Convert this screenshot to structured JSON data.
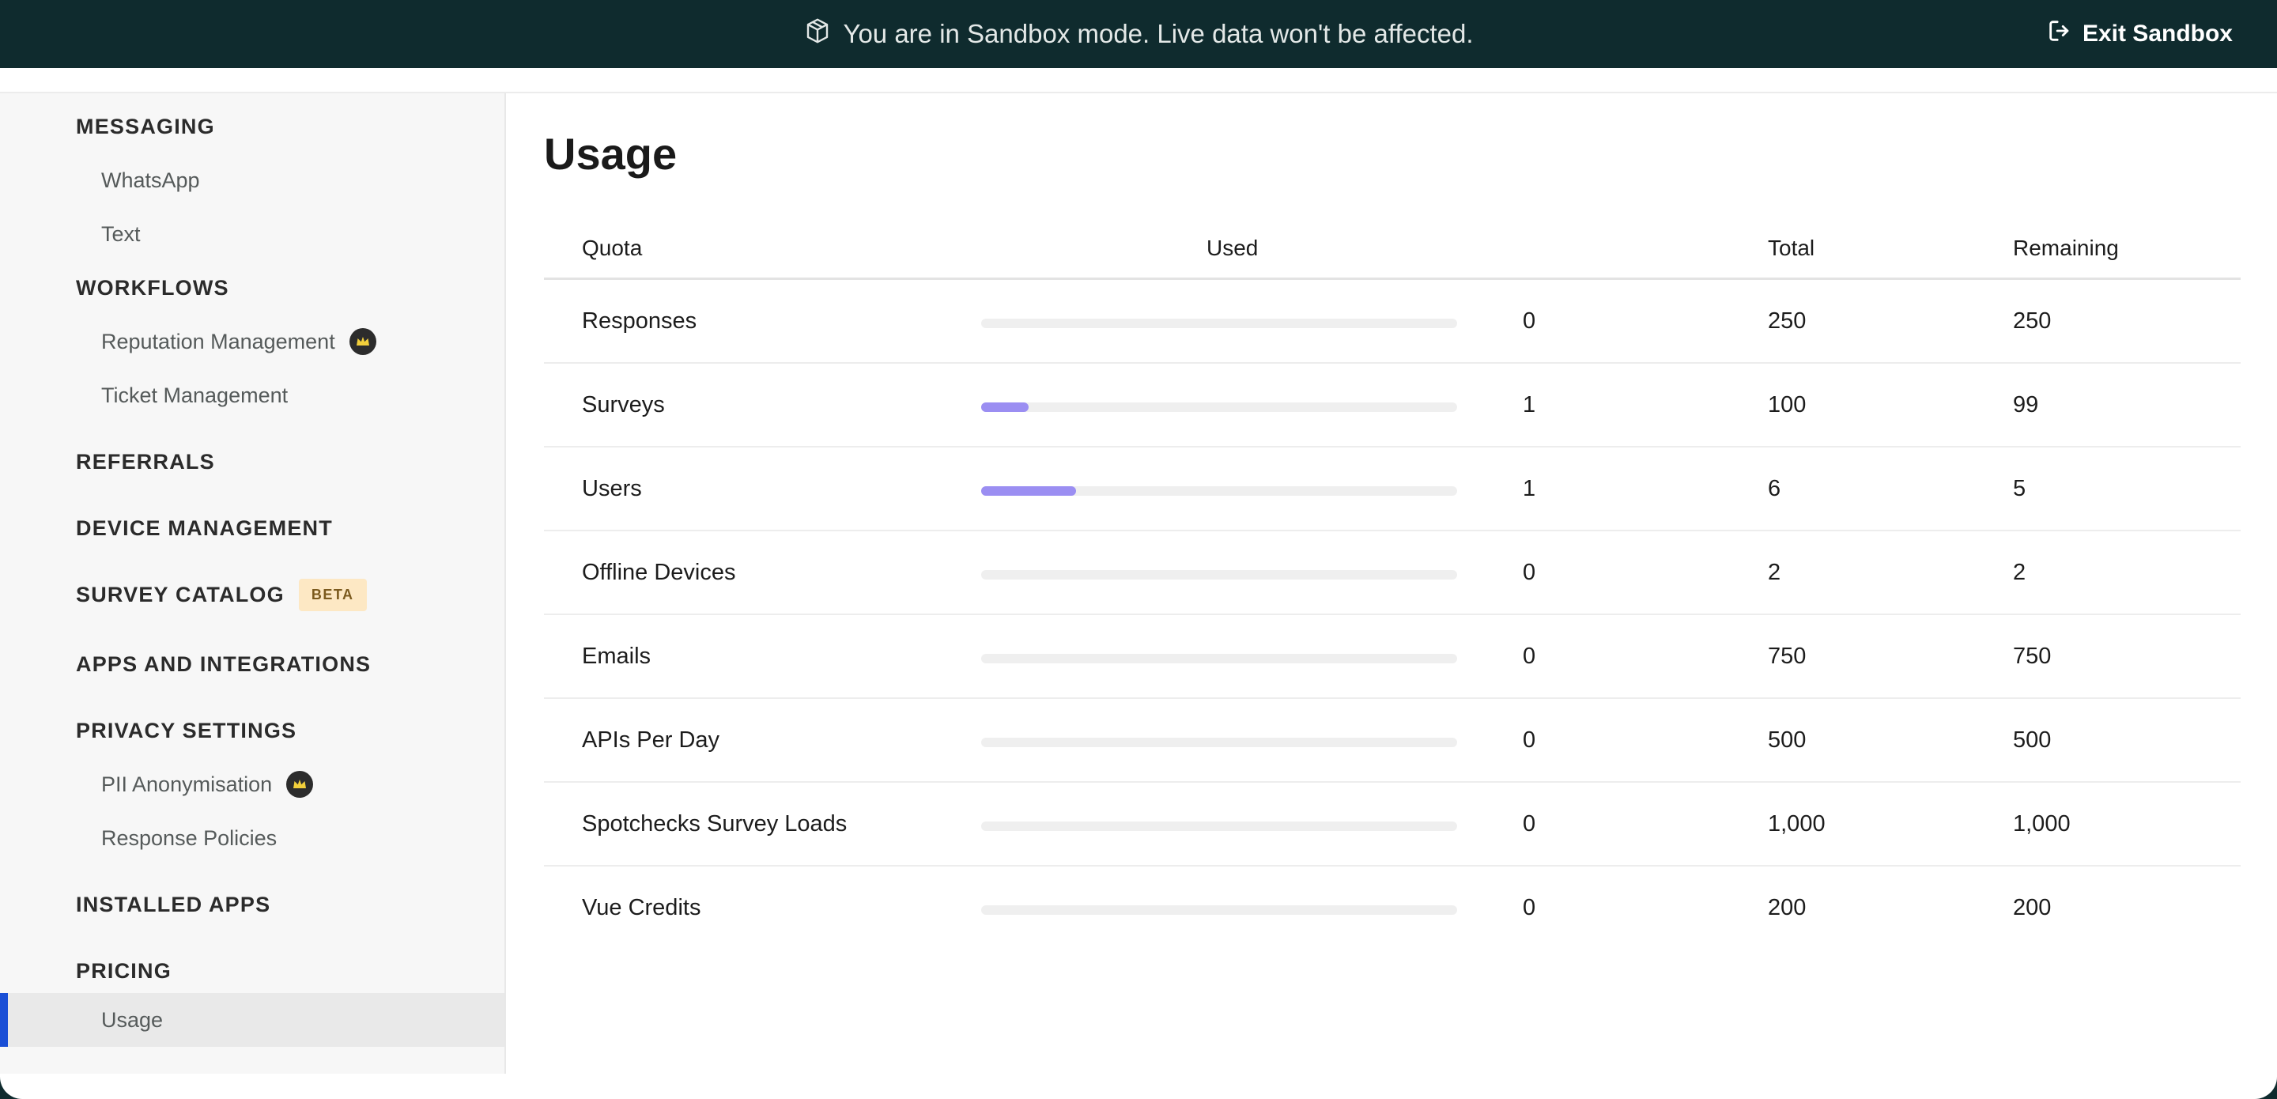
{
  "banner": {
    "message": "You are in Sandbox mode. Live data won't be affected.",
    "exit_label": "Exit Sandbox",
    "icon": "package-icon"
  },
  "sidebar": {
    "items": [
      {
        "label": "MESSAGING",
        "kind": "section"
      },
      {
        "label": "WhatsApp",
        "kind": "sub"
      },
      {
        "label": "Text",
        "kind": "sub"
      },
      {
        "label": "WORKFLOWS",
        "kind": "section"
      },
      {
        "label": "Reputation Management",
        "kind": "sub",
        "badge": "crown-icon"
      },
      {
        "label": "Ticket Management",
        "kind": "sub"
      },
      {
        "label": "REFERRALS",
        "kind": "section"
      },
      {
        "label": "DEVICE MANAGEMENT",
        "kind": "section"
      },
      {
        "label": "SURVEY CATALOG",
        "kind": "section",
        "tag": "BETA"
      },
      {
        "label": "APPS AND INTEGRATIONS",
        "kind": "section"
      },
      {
        "label": "PRIVACY SETTINGS",
        "kind": "section"
      },
      {
        "label": "PII Anonymisation",
        "kind": "sub",
        "badge": "crown-icon"
      },
      {
        "label": "Response Policies",
        "kind": "sub"
      },
      {
        "label": "INSTALLED APPS",
        "kind": "section"
      },
      {
        "label": "PRICING",
        "kind": "section"
      },
      {
        "label": "Usage",
        "kind": "sub",
        "active": true
      }
    ]
  },
  "main": {
    "title": "Usage",
    "table": {
      "headers": {
        "quota": "Quota",
        "used": "Used",
        "total": "Total",
        "remaining": "Remaining"
      },
      "rows": [
        {
          "quota": "Responses",
          "used": "0",
          "total": "250",
          "remaining": "250",
          "fraction": 0
        },
        {
          "quota": "Surveys",
          "used": "1",
          "total": "100",
          "remaining": "99",
          "fraction": 0.1
        },
        {
          "quota": "Users",
          "used": "1",
          "total": "6",
          "remaining": "5",
          "fraction": 0.2
        },
        {
          "quota": "Offline Devices",
          "used": "0",
          "total": "2",
          "remaining": "2",
          "fraction": 0
        },
        {
          "quota": "Emails",
          "used": "0",
          "total": "750",
          "remaining": "750",
          "fraction": 0
        },
        {
          "quota": "APIs Per Day",
          "used": "0",
          "total": "500",
          "remaining": "500",
          "fraction": 0
        },
        {
          "quota": "Spotchecks Survey Loads",
          "used": "0",
          "total": "1,000",
          "remaining": "1,000",
          "fraction": 0
        },
        {
          "quota": "Vue Credits",
          "used": "0",
          "total": "200",
          "remaining": "200",
          "fraction": 0
        }
      ]
    }
  },
  "colors": {
    "banner_bg": "#0f2b2e",
    "bar_fill": "#9b8ef2",
    "active_indicator": "#1a4fd6",
    "beta_bg": "#fde8c4"
  }
}
